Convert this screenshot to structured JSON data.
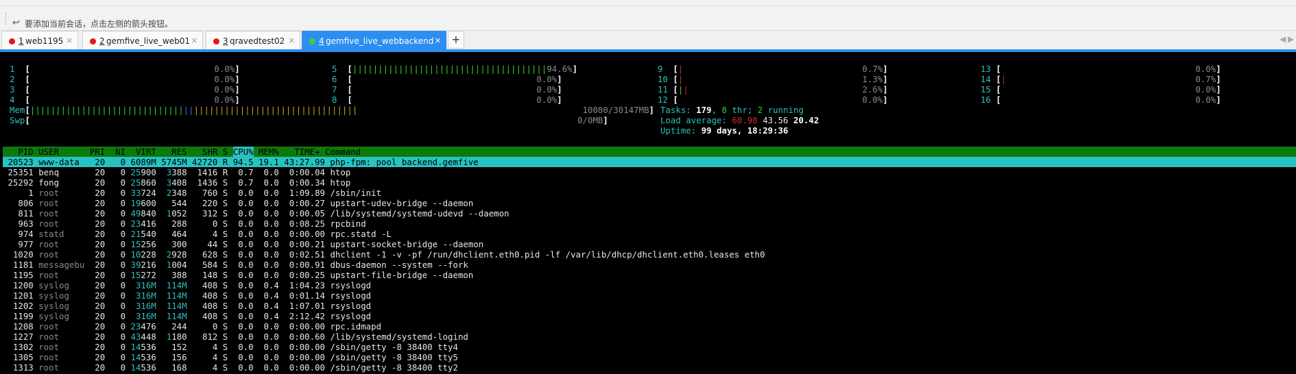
{
  "infobar": {
    "text": "要添加当前会话，点击左侧的箭头按钮。",
    "icon": "session-add-icon"
  },
  "tabs": [
    {
      "num": "1",
      "label": "web1195",
      "status": "red"
    },
    {
      "num": "2",
      "label": "gemfive_live_web01",
      "status": "red"
    },
    {
      "num": "3",
      "label": "qravedtest02",
      "status": "red"
    },
    {
      "num": "4",
      "label": "gemfive_live_webbackend",
      "status": "green",
      "active": true
    }
  ],
  "colors": {
    "accent": "#2c8ef0",
    "terminal_bg": "#000000",
    "header_green": "#0d7a0d",
    "selected_row": "#27c3c3"
  },
  "htop": {
    "cpus": [
      {
        "id": "1",
        "pct": "0.0%"
      },
      {
        "id": "2",
        "pct": "0.0%"
      },
      {
        "id": "3",
        "pct": "0.0%"
      },
      {
        "id": "4",
        "pct": "0.0%"
      },
      {
        "id": "5",
        "pct": "94.6%"
      },
      {
        "id": "6",
        "pct": "0.0%"
      },
      {
        "id": "7",
        "pct": "0.0%"
      },
      {
        "id": "8",
        "pct": "0.0%"
      },
      {
        "id": "9",
        "pct": "0.7%"
      },
      {
        "id": "10",
        "pct": "1.3%"
      },
      {
        "id": "11",
        "pct": "2.6%"
      },
      {
        "id": "12",
        "pct": "0.0%"
      },
      {
        "id": "13",
        "pct": "0.0%"
      },
      {
        "id": "14",
        "pct": "0.7%"
      },
      {
        "id": "15",
        "pct": "0.0%"
      },
      {
        "id": "16",
        "pct": "0.0%"
      }
    ],
    "mem": {
      "label": "Mem",
      "value": "10080/30147MB"
    },
    "swp": {
      "label": "Swp",
      "value": "0/0MB"
    },
    "tasks": {
      "label": "Tasks:",
      "count": "179",
      "thr": "8",
      "thr_label": " thr;",
      "running": "2",
      "running_label": " running"
    },
    "load": {
      "label": "Load average:",
      "v1": "68.98",
      "v5": "43.56",
      "v15": "20.42"
    },
    "uptime": {
      "label": "Uptime:",
      "value": "99 days, 18:29:36"
    },
    "header": [
      "PID",
      "USER",
      "PRI",
      "NI",
      "VIRT",
      "RES",
      "SHR",
      "S",
      "CPU%",
      "MEM%",
      "TIME+",
      "Command"
    ],
    "processes": [
      [
        "20523",
        "www-data",
        "20",
        "0",
        "6089M",
        "5745M",
        "42720",
        "R",
        "94.5",
        "19.1",
        "43:27.99",
        "php-fpm: pool backend.gemfive"
      ],
      [
        "25351",
        "benq",
        "20",
        "0",
        "25900",
        "3388",
        "1416",
        "R",
        "0.7",
        "0.0",
        "0:00.04",
        "htop"
      ],
      [
        "25292",
        "fong",
        "20",
        "0",
        "25860",
        "3408",
        "1436",
        "S",
        "0.7",
        "0.0",
        "0:00.34",
        "htop"
      ],
      [
        "1",
        "root",
        "20",
        "0",
        "33724",
        "2348",
        "760",
        "S",
        "0.0",
        "0.0",
        "1:09.89",
        "/sbin/init"
      ],
      [
        "806",
        "root",
        "20",
        "0",
        "19600",
        "544",
        "220",
        "S",
        "0.0",
        "0.0",
        "0:00.27",
        "upstart-udev-bridge --daemon"
      ],
      [
        "811",
        "root",
        "20",
        "0",
        "49840",
        "1052",
        "312",
        "S",
        "0.0",
        "0.0",
        "0:00.05",
        "/lib/systemd/systemd-udevd --daemon"
      ],
      [
        "963",
        "root",
        "20",
        "0",
        "23416",
        "288",
        "0",
        "S",
        "0.0",
        "0.0",
        "0:08.25",
        "rpcbind"
      ],
      [
        "974",
        "statd",
        "20",
        "0",
        "21540",
        "464",
        "4",
        "S",
        "0.0",
        "0.0",
        "0:00.00",
        "rpc.statd -L"
      ],
      [
        "977",
        "root",
        "20",
        "0",
        "15256",
        "300",
        "44",
        "S",
        "0.0",
        "0.0",
        "0:00.21",
        "upstart-socket-bridge --daemon"
      ],
      [
        "1020",
        "root",
        "20",
        "0",
        "10228",
        "2928",
        "628",
        "S",
        "0.0",
        "0.0",
        "0:02.51",
        "dhclient -1 -v -pf /run/dhclient.eth0.pid -lf /var/lib/dhcp/dhclient.eth0.leases eth0"
      ],
      [
        "1181",
        "messagebu",
        "20",
        "0",
        "39216",
        "1004",
        "584",
        "S",
        "0.0",
        "0.0",
        "0:00.91",
        "dbus-daemon --system --fork"
      ],
      [
        "1195",
        "root",
        "20",
        "0",
        "15272",
        "388",
        "148",
        "S",
        "0.0",
        "0.0",
        "0:00.25",
        "upstart-file-bridge --daemon"
      ],
      [
        "1200",
        "syslog",
        "20",
        "0",
        "316M",
        "114M",
        "408",
        "S",
        "0.0",
        "0.4",
        "1:04.23",
        "rsyslogd"
      ],
      [
        "1201",
        "syslog",
        "20",
        "0",
        "316M",
        "114M",
        "408",
        "S",
        "0.0",
        "0.4",
        "0:01.14",
        "rsyslogd"
      ],
      [
        "1202",
        "syslog",
        "20",
        "0",
        "316M",
        "114M",
        "408",
        "S",
        "0.0",
        "0.4",
        "1:07.01",
        "rsyslogd"
      ],
      [
        "1199",
        "syslog",
        "20",
        "0",
        "316M",
        "114M",
        "408",
        "S",
        "0.0",
        "0.4",
        "2:12.42",
        "rsyslogd"
      ],
      [
        "1208",
        "root",
        "20",
        "0",
        "23476",
        "244",
        "0",
        "S",
        "0.0",
        "0.0",
        "0:00.00",
        "rpc.idmapd"
      ],
      [
        "1227",
        "root",
        "20",
        "0",
        "43448",
        "1180",
        "812",
        "S",
        "0.0",
        "0.0",
        "0:00.60",
        "/lib/systemd/systemd-logind"
      ],
      [
        "1302",
        "root",
        "20",
        "0",
        "14536",
        "152",
        "4",
        "S",
        "0.0",
        "0.0",
        "0:00.00",
        "/sbin/getty -8 38400 tty4"
      ],
      [
        "1305",
        "root",
        "20",
        "0",
        "14536",
        "156",
        "4",
        "S",
        "0.0",
        "0.0",
        "0:00.00",
        "/sbin/getty -8 38400 tty5"
      ],
      [
        "1313",
        "root",
        "20",
        "0",
        "14536",
        "168",
        "4",
        "S",
        "0.0",
        "0.0",
        "0:00.00",
        "/sbin/getty -8 38400 tty2"
      ]
    ]
  }
}
